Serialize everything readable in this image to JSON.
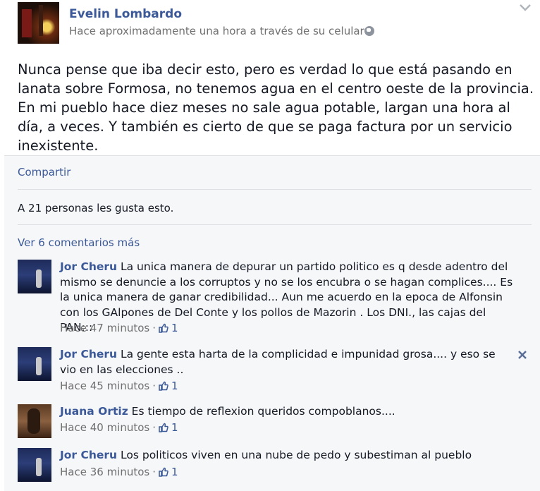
{
  "post": {
    "author": "Evelin Lombardo",
    "meta": "Hace aproximadamente una hora a través de su celular",
    "text": "Nunca pense que iba decir esto, pero es verdad lo que está pasando en lanata sobre Formosa, no tenemos agua en el centro oeste de la provincia. En mi pueblo hace diez meses no sale agua potable, largan una hora al día, a veces. Y también es cierto de que se paga factura por un servicio inexistente."
  },
  "feedback": {
    "share_label": "Compartir",
    "likes_text": "A 21 personas les gusta esto.",
    "more_comments_label": "Ver 6 comentarios más"
  },
  "comments": [
    {
      "name": "Jor Cheru",
      "text": "La unica manera de depurar un partido politico es q desde adentro del mismo se denuncie a los corruptos y no se los encubra o se hagan complices.... Es la unica manera de ganar credibilidad... Aun me acuerdo en la epoca de Alfonsin con los GAlpones de Del Conte y los pollos de Mazorin . Los DNI., las cajas del PAN:::",
      "time": "Hace 47 minutos",
      "likes": "1"
    },
    {
      "name": "Jor Cheru",
      "text": "La gente esta harta de la complicidad e impunidad grosa.... y eso se vio en las elecciones ..",
      "time": "Hace 45 minutos",
      "likes": "1"
    },
    {
      "name": "Juana Ortiz",
      "text": "Es tiempo de reflexion queridos compoblanos....",
      "time": "Hace 40 minutos",
      "likes": "1"
    },
    {
      "name": "Jor Cheru",
      "text": "Los politicos viven en una nube de pedo y subestiman al pueblo",
      "time": "Hace 36 minutos",
      "likes": "1"
    }
  ],
  "meta_separator": "·",
  "icons": {
    "options": "chevron-down-icon",
    "privacy": "globe-icon",
    "like": "thumbs-up-icon",
    "remove": "close-icon"
  },
  "colors": {
    "link": "#3b5998",
    "text": "#141823",
    "muted": "#6f6f6f",
    "feedback_bg": "#f6f7f9"
  }
}
